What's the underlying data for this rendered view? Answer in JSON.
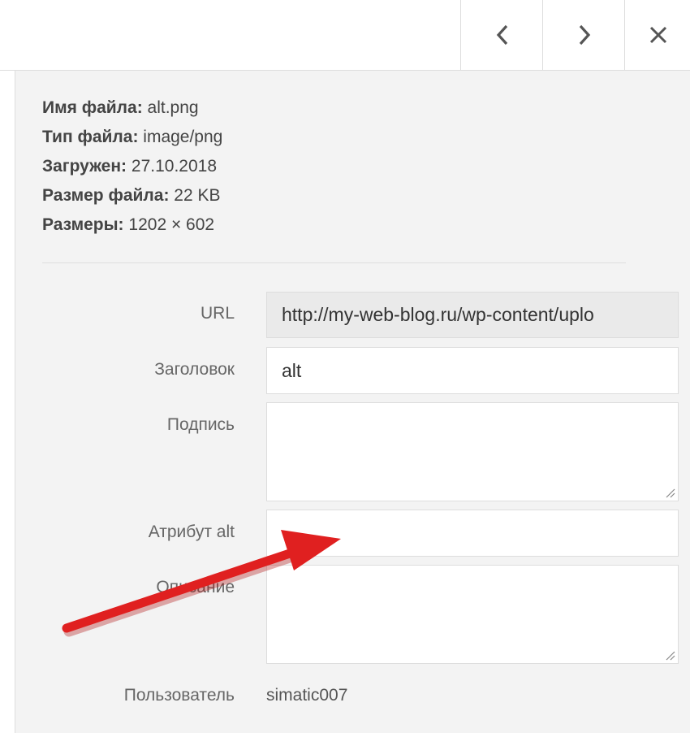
{
  "toolbar": {
    "prev_icon": "chevron-left-icon",
    "next_icon": "chevron-right-icon",
    "close_icon": "close-icon"
  },
  "details": {
    "file_name_label": "Имя файла:",
    "file_name": "alt.png",
    "file_type_label": "Тип файла:",
    "file_type": "image/png",
    "uploaded_label": "Загружен:",
    "uploaded": "27.10.2018",
    "file_size_label": "Размер файла:",
    "file_size": "22 KB",
    "dimensions_label": "Размеры:",
    "dimensions": "1202 × 602"
  },
  "form": {
    "url_label": "URL",
    "url_value": "http://my-web-blog.ru/wp-content/uplo",
    "title_label": "Заголовок",
    "title_value": "alt",
    "caption_label": "Подпись",
    "caption_value": "",
    "alt_label": "Атрибут alt",
    "alt_value": "",
    "description_label": "Описание",
    "description_value": "",
    "user_label": "Пользователь",
    "user_value": "simatic007"
  },
  "colors": {
    "panel_bg": "#f3f3f3",
    "annotation_arrow": "#e02020"
  }
}
